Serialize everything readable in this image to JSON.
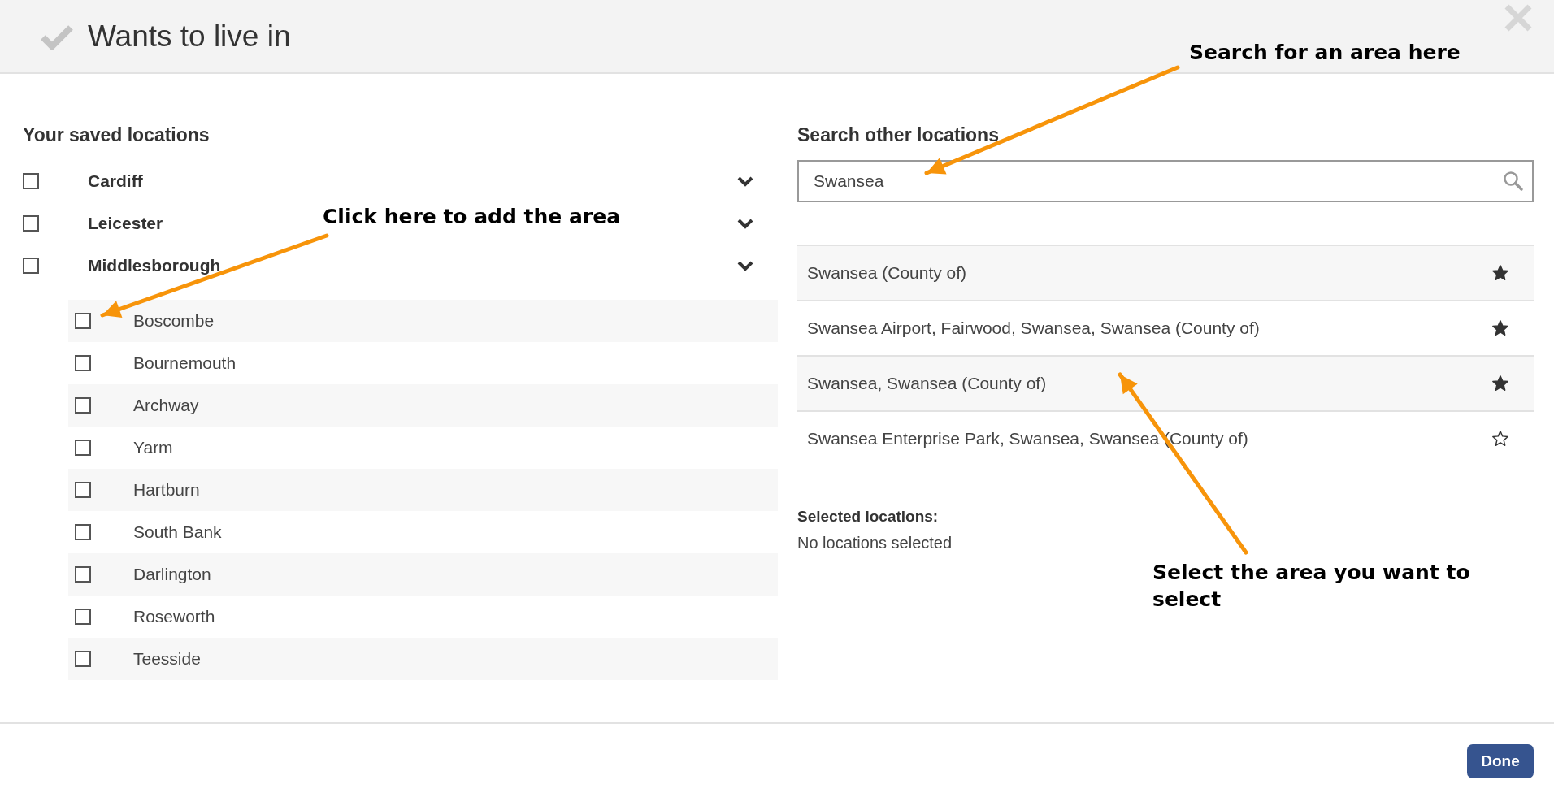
{
  "dialog": {
    "title": "Wants to live in"
  },
  "saved": {
    "heading": "Your saved locations",
    "items": [
      {
        "label": "Cardiff",
        "checked": false
      },
      {
        "label": "Leicester",
        "checked": false
      },
      {
        "label": "Middlesborough",
        "checked": false,
        "children": [
          {
            "label": "Boscombe",
            "checked": false
          },
          {
            "label": "Bournemouth",
            "checked": false
          },
          {
            "label": "Archway",
            "checked": false
          },
          {
            "label": "Yarm",
            "checked": false
          },
          {
            "label": "Hartburn",
            "checked": false
          },
          {
            "label": "South Bank",
            "checked": false
          },
          {
            "label": "Darlington",
            "checked": false
          },
          {
            "label": "Roseworth",
            "checked": false
          },
          {
            "label": "Teesside",
            "checked": false
          }
        ]
      }
    ]
  },
  "search": {
    "heading": "Search other locations",
    "value": "Swansea",
    "results": [
      {
        "label": "Swansea (County of)",
        "starred": true
      },
      {
        "label": "Swansea Airport, Fairwood, Swansea, Swansea (County of)",
        "starred": true
      },
      {
        "label": "Swansea, Swansea (County of)",
        "starred": true
      },
      {
        "label": "Swansea Enterprise Park, Swansea, Swansea (County of)",
        "starred": false
      }
    ]
  },
  "selected": {
    "heading": "Selected locations:",
    "empty_text": "No locations selected"
  },
  "footer": {
    "button": "Done"
  },
  "annotations": [
    {
      "text": "Search for an area here"
    },
    {
      "text": "Click here to add the area"
    },
    {
      "text": "Select the area you want to select"
    }
  ]
}
